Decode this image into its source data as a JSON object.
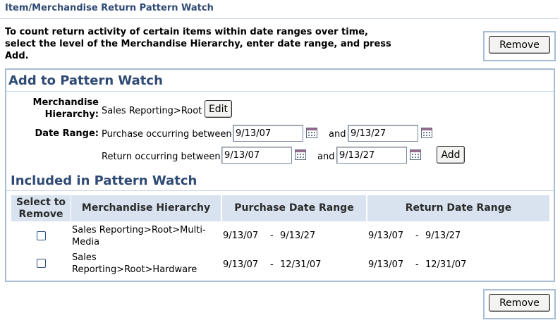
{
  "header": {
    "title": "Item/Merchandise Return Pattern Watch",
    "instructions": "To count return activity of certain items within date ranges over time, select the level of the Merchandise Hierarchy, enter date range, and press Add."
  },
  "buttons": {
    "remove_label": "Remove",
    "edit_label": "Edit",
    "add_label": "Add"
  },
  "add_section": {
    "title": "Add to Pattern Watch",
    "hierarchy_label_line1": "Merchandise",
    "hierarchy_label_line2": "Hierarchy:",
    "hierarchy_value": "Sales Reporting>Root",
    "date_range_label": "Date Range:",
    "purchase_label": "Purchase occurring between",
    "return_label": "Return occurring between",
    "and_label": "and",
    "purchase_from": "9/13/07",
    "purchase_to": "9/13/27",
    "return_from": "9/13/07",
    "return_to": "9/13/27"
  },
  "included_section": {
    "title": "Included in Pattern Watch",
    "columns": {
      "select_line1": "Select to",
      "select_line2": "Remove",
      "hierarchy": "Merchandise Hierarchy",
      "purchase": "Purchase Date Range",
      "return": "Return Date Range"
    },
    "dash": "-",
    "rows": [
      {
        "hierarchy_line1": "Sales Reporting>Root>Multi-",
        "hierarchy_line2": "Media",
        "purchase_from": "9/13/07",
        "purchase_to": "9/13/27",
        "return_from": "9/13/07",
        "return_to": "9/13/27",
        "checked": false
      },
      {
        "hierarchy_line1": "Sales",
        "hierarchy_line2": "Reporting>Root>Hardware",
        "purchase_from": "9/13/07",
        "purchase_to": "12/31/07",
        "return_from": "9/13/07",
        "return_to": "12/31/07",
        "checked": false
      }
    ]
  },
  "icons": {
    "calendar": "calendar-icon",
    "checkbox": "checkbox"
  },
  "colors": {
    "title_blue": "#2f4a74",
    "border_blue": "#a9bcd6",
    "header_bg": "#d8e3ef"
  }
}
